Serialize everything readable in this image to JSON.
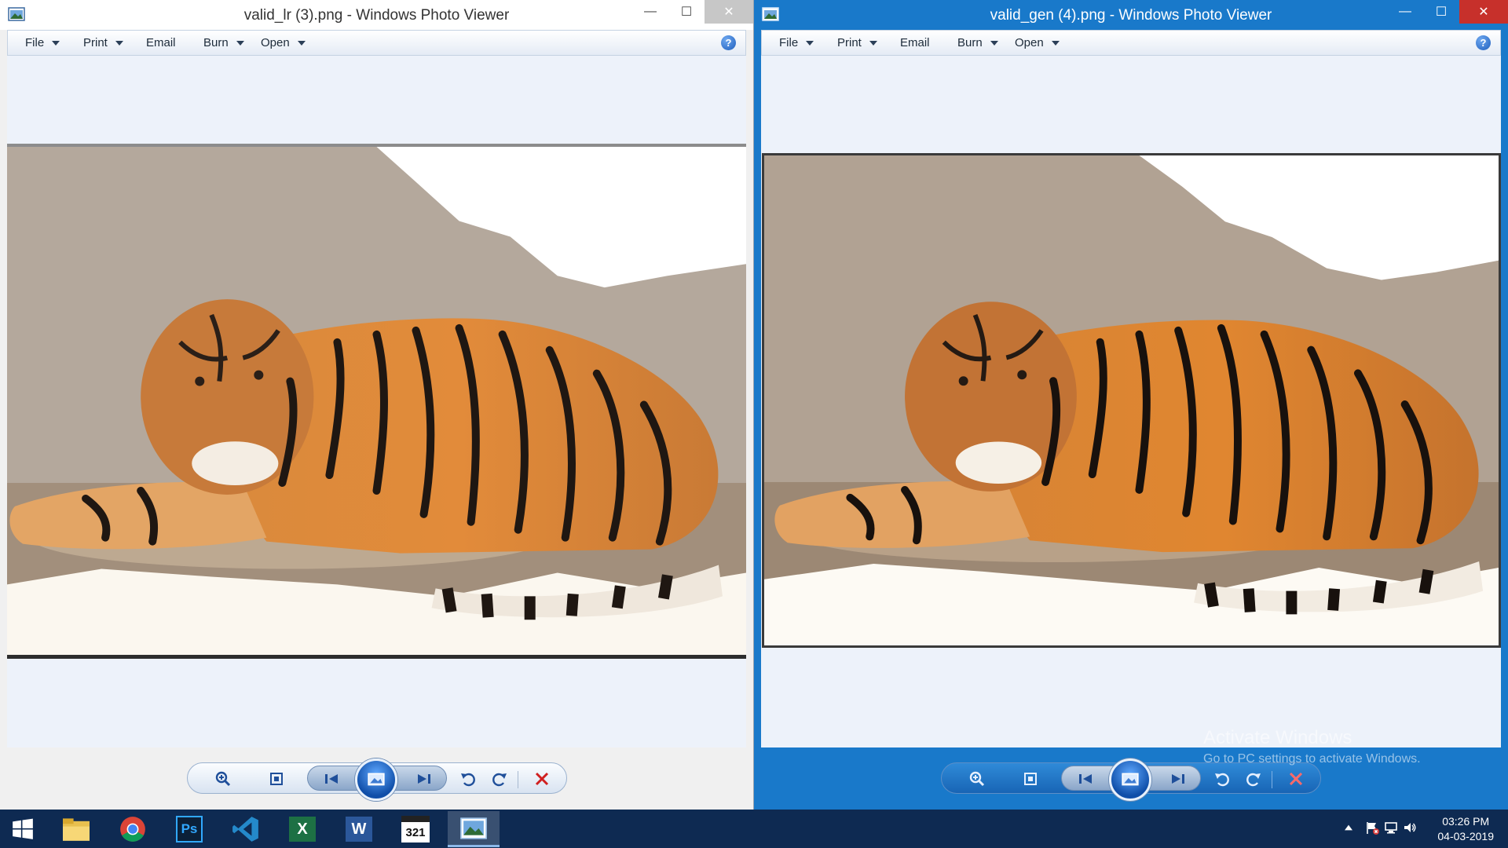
{
  "left_window": {
    "title": "valid_lr (3).png - Windows Photo Viewer",
    "menu": {
      "file": "File",
      "print": "Print",
      "email": "Email",
      "burn": "Burn",
      "open": "Open"
    },
    "help": "?"
  },
  "right_window": {
    "title": "valid_gen (4).png - Windows Photo Viewer",
    "menu": {
      "file": "File",
      "print": "Print",
      "email": "Email",
      "burn": "Burn",
      "open": "Open"
    },
    "help": "?"
  },
  "caption_buttons": {
    "minimize": "—",
    "maximize": "☐",
    "close": "✕"
  },
  "controls_icons": [
    "zoom-icon",
    "actual-size-icon",
    "previous-icon",
    "slideshow-icon",
    "next-icon",
    "rotate-left-icon",
    "rotate-right-icon",
    "delete-icon"
  ],
  "watermark": {
    "title": "Activate Windows",
    "subtitle": "Go to PC settings to activate Windows."
  },
  "taskbar": {
    "apps": [
      "start-icon",
      "file-explorer-icon",
      "chrome-icon",
      "photoshop-icon",
      "vscode-icon",
      "excel-icon",
      "word-icon",
      "calendar-app-icon",
      "photo-viewer-icon"
    ],
    "photoshop_label": "Ps",
    "excel_label": "X",
    "word_label": "W",
    "calendar_label": "321"
  },
  "clock": {
    "time": "03:26 PM",
    "date": "04-03-2019"
  },
  "colors": {
    "active_titlebar": "#1979ca",
    "taskbar": "#0e2a52",
    "viewer_background": "#edf2fa"
  }
}
